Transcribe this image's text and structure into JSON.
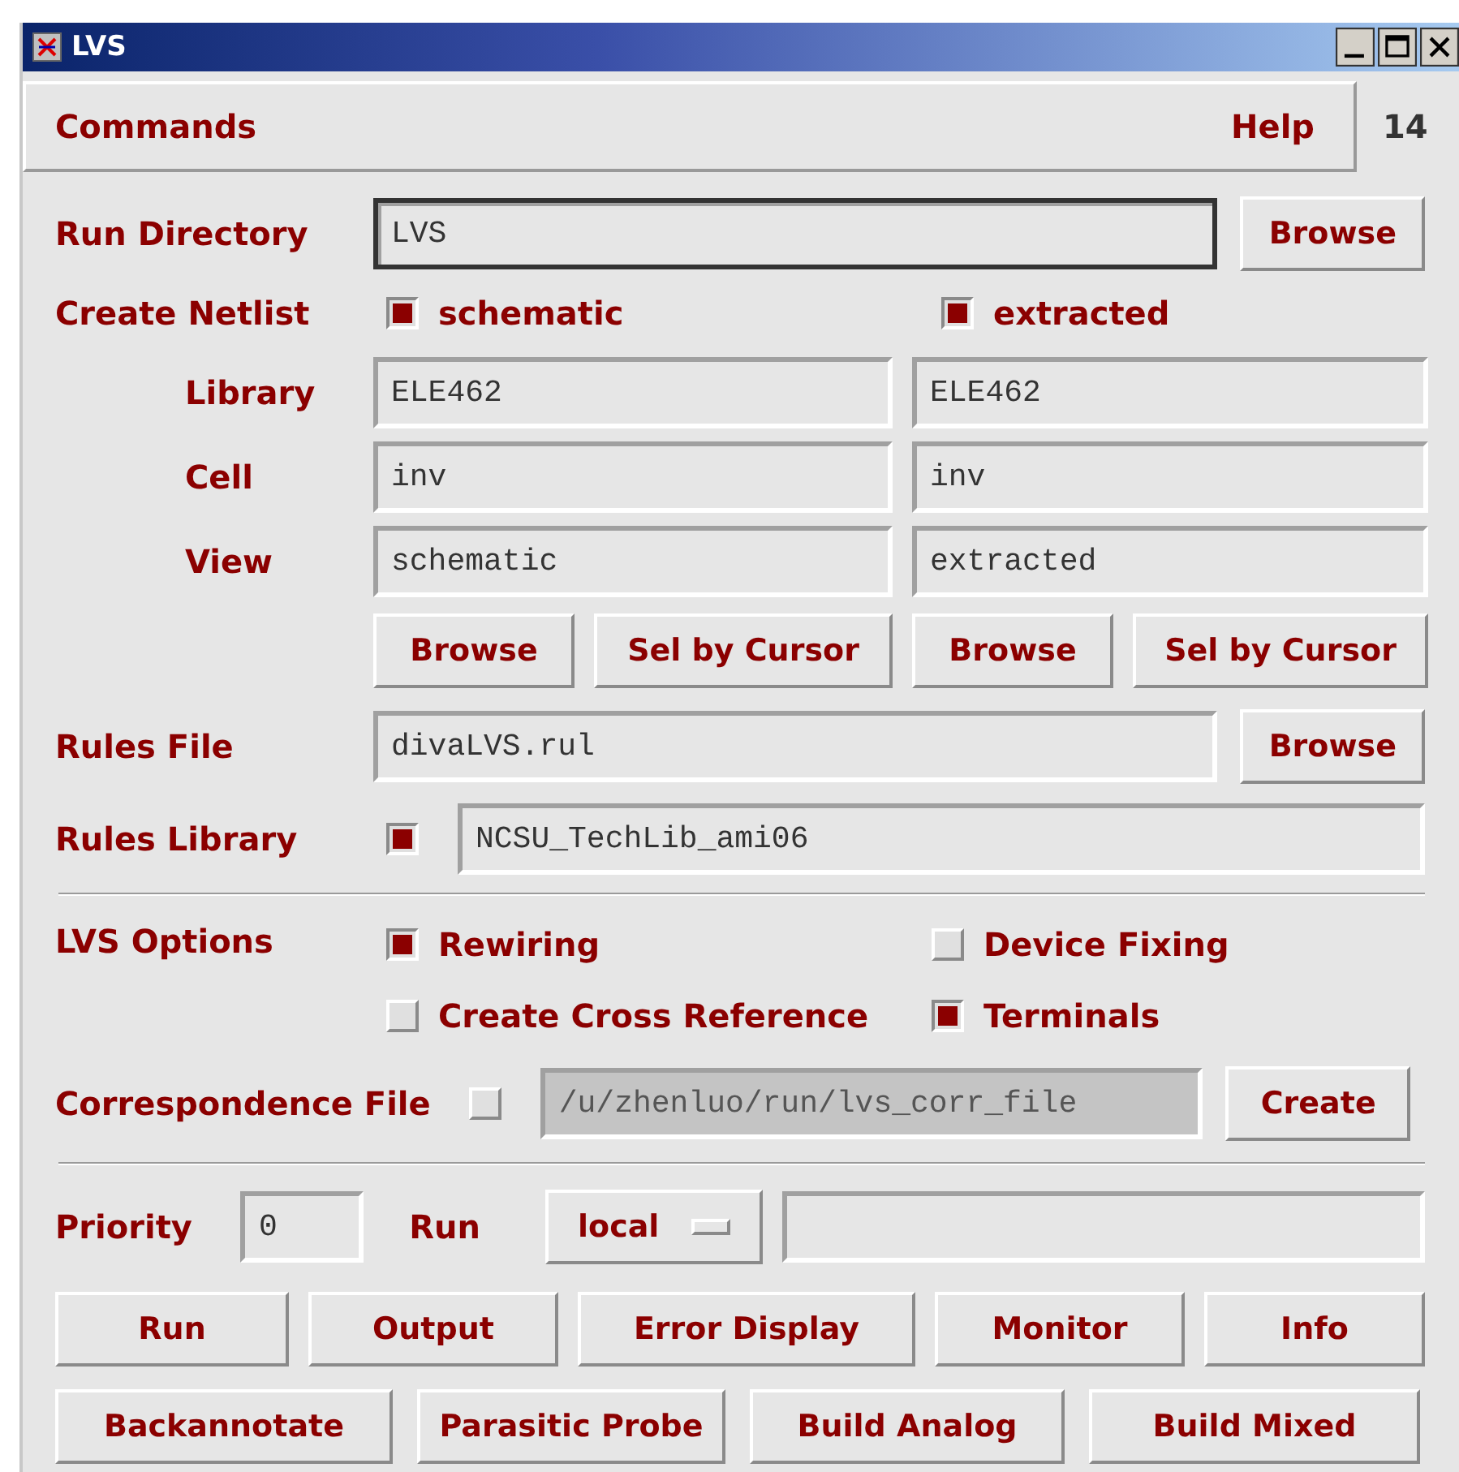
{
  "window": {
    "title": "LVS"
  },
  "menu": [
    {
      "label": "Commands"
    },
    {
      "label": "Help"
    }
  ],
  "menu_counter": "14",
  "run_directory": {
    "label": "Run Directory",
    "value": "LVS",
    "focused": true,
    "button": "Browse"
  },
  "create_netlist": {
    "label": "Create Netlist",
    "field_labels": [
      "Library",
      "Cell",
      "View"
    ],
    "sources": [
      {
        "name": "schematic",
        "checked": true,
        "library": "ELE462",
        "cell": "inv",
        "view": "schematic",
        "buttons": [
          "Browse",
          "Sel by Cursor"
        ]
      },
      {
        "name": "extracted",
        "checked": true,
        "library": "ELE462",
        "cell": "inv",
        "view": "extracted",
        "buttons": [
          "Browse",
          "Sel by Cursor"
        ]
      }
    ]
  },
  "rules_file": {
    "label": "Rules File",
    "value": "divaLVS.rul",
    "button": "Browse"
  },
  "rules_library": {
    "label": "Rules Library",
    "checked": true,
    "value": "NCSU_TechLib_ami06"
  },
  "lvs_options": {
    "label": "LVS Options",
    "options": [
      {
        "label": "Rewiring",
        "checked": true
      },
      {
        "label": "Device Fixing",
        "checked": false
      },
      {
        "label": "Create Cross Reference",
        "checked": false
      },
      {
        "label": "Terminals",
        "checked": true
      }
    ]
  },
  "correspondence_file": {
    "label": "Correspondence File",
    "checked": false,
    "value": "/u/zhenluo/run/lvs_corr_file",
    "disabled": true,
    "button": "Create"
  },
  "priority": {
    "label": "Priority",
    "value": "0"
  },
  "run": {
    "label": "Run",
    "mode": "local"
  },
  "actions": [
    [
      "Run",
      "Output",
      "Error Display",
      "Monitor",
      "Info"
    ],
    [
      "Backannotate",
      "Parasitic Probe",
      "Build Analog",
      "Build Mixed"
    ]
  ]
}
